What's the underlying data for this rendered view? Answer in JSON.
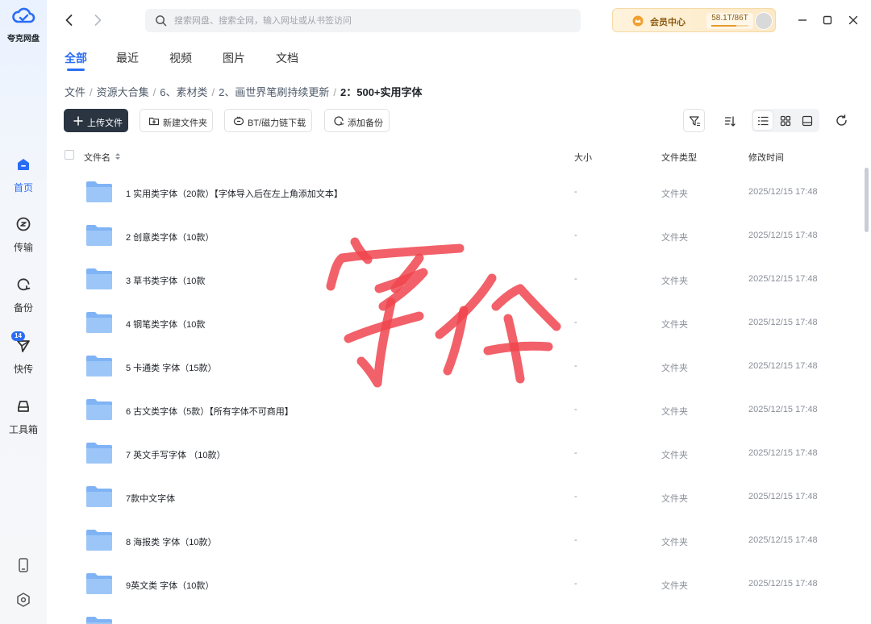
{
  "app": {
    "name": "夸克网盘"
  },
  "sidebar": {
    "items": [
      {
        "label": "首页",
        "icon": "home-icon",
        "active": true
      },
      {
        "label": "传输",
        "icon": "transfer-icon"
      },
      {
        "label": "备份",
        "icon": "backup-icon"
      },
      {
        "label": "快传",
        "icon": "quick-send-icon",
        "badge": "14"
      },
      {
        "label": "工具箱",
        "icon": "toolbox-icon"
      }
    ],
    "bottom_icons": [
      "phone-icon",
      "settings-icon"
    ]
  },
  "topbar": {
    "search_placeholder": "搜索网盘、搜索全网，输入网址或从书签访问",
    "member_label": "会员中心",
    "quota": "58.1T/86T",
    "quota_fraction": 0.676
  },
  "tabs": [
    "全部",
    "最近",
    "视频",
    "图片",
    "文档"
  ],
  "active_tab": 0,
  "breadcrumb": [
    "文件",
    "资源大合集",
    "6、素材类",
    "2、画世界笔刷持续更新",
    "2：500+实用字体"
  ],
  "toolbar": {
    "upload": "上传文件",
    "new_folder": "新建文件夹",
    "bt": "BT/磁力链下载",
    "backup": "添加备份"
  },
  "table": {
    "headers": {
      "name": "文件名",
      "size": "大小",
      "type": "文件类型",
      "time": "修改时间"
    },
    "rows": [
      {
        "name": "1 实用类字体（20款）【字体导入后在左上角添加文本】",
        "size": "-",
        "type": "文件夹",
        "time": "2025/12/15 17:48"
      },
      {
        "name": "2 创意类字体（10款）",
        "size": "-",
        "type": "文件夹",
        "time": "2025/12/15 17:48"
      },
      {
        "name": "3 草书类字体（10款",
        "size": "-",
        "type": "文件夹",
        "time": "2025/12/15 17:48"
      },
      {
        "name": "4 钢笔类字体（10款",
        "size": "-",
        "type": "文件夹",
        "time": "2025/12/15 17:48"
      },
      {
        "name": "5 卡通类 字体（15款）",
        "size": "-",
        "type": "文件夹",
        "time": "2025/12/15 17:48"
      },
      {
        "name": "6 古文类字体（5款）【所有字体不可商用】",
        "size": "-",
        "type": "文件夹",
        "time": "2025/12/15 17:48"
      },
      {
        "name": "7 英文手写字体 （10款）",
        "size": "-",
        "type": "文件夹",
        "time": "2025/12/15 17:48"
      },
      {
        "name": "7款中文字体",
        "size": "-",
        "type": "文件夹",
        "time": "2025/12/15 17:48"
      },
      {
        "name": "8 海报类 字体（10款）",
        "size": "-",
        "type": "文件夹",
        "time": "2025/12/15 17:48"
      },
      {
        "name": "9英文类 字体（10款）",
        "size": "-",
        "type": "文件夹",
        "time": "2025/12/15 17:48"
      },
      {
        "name": "",
        "size": "",
        "type": "",
        "time": ""
      }
    ]
  },
  "annotation": {
    "text": "字体",
    "color": "#f0454f"
  }
}
